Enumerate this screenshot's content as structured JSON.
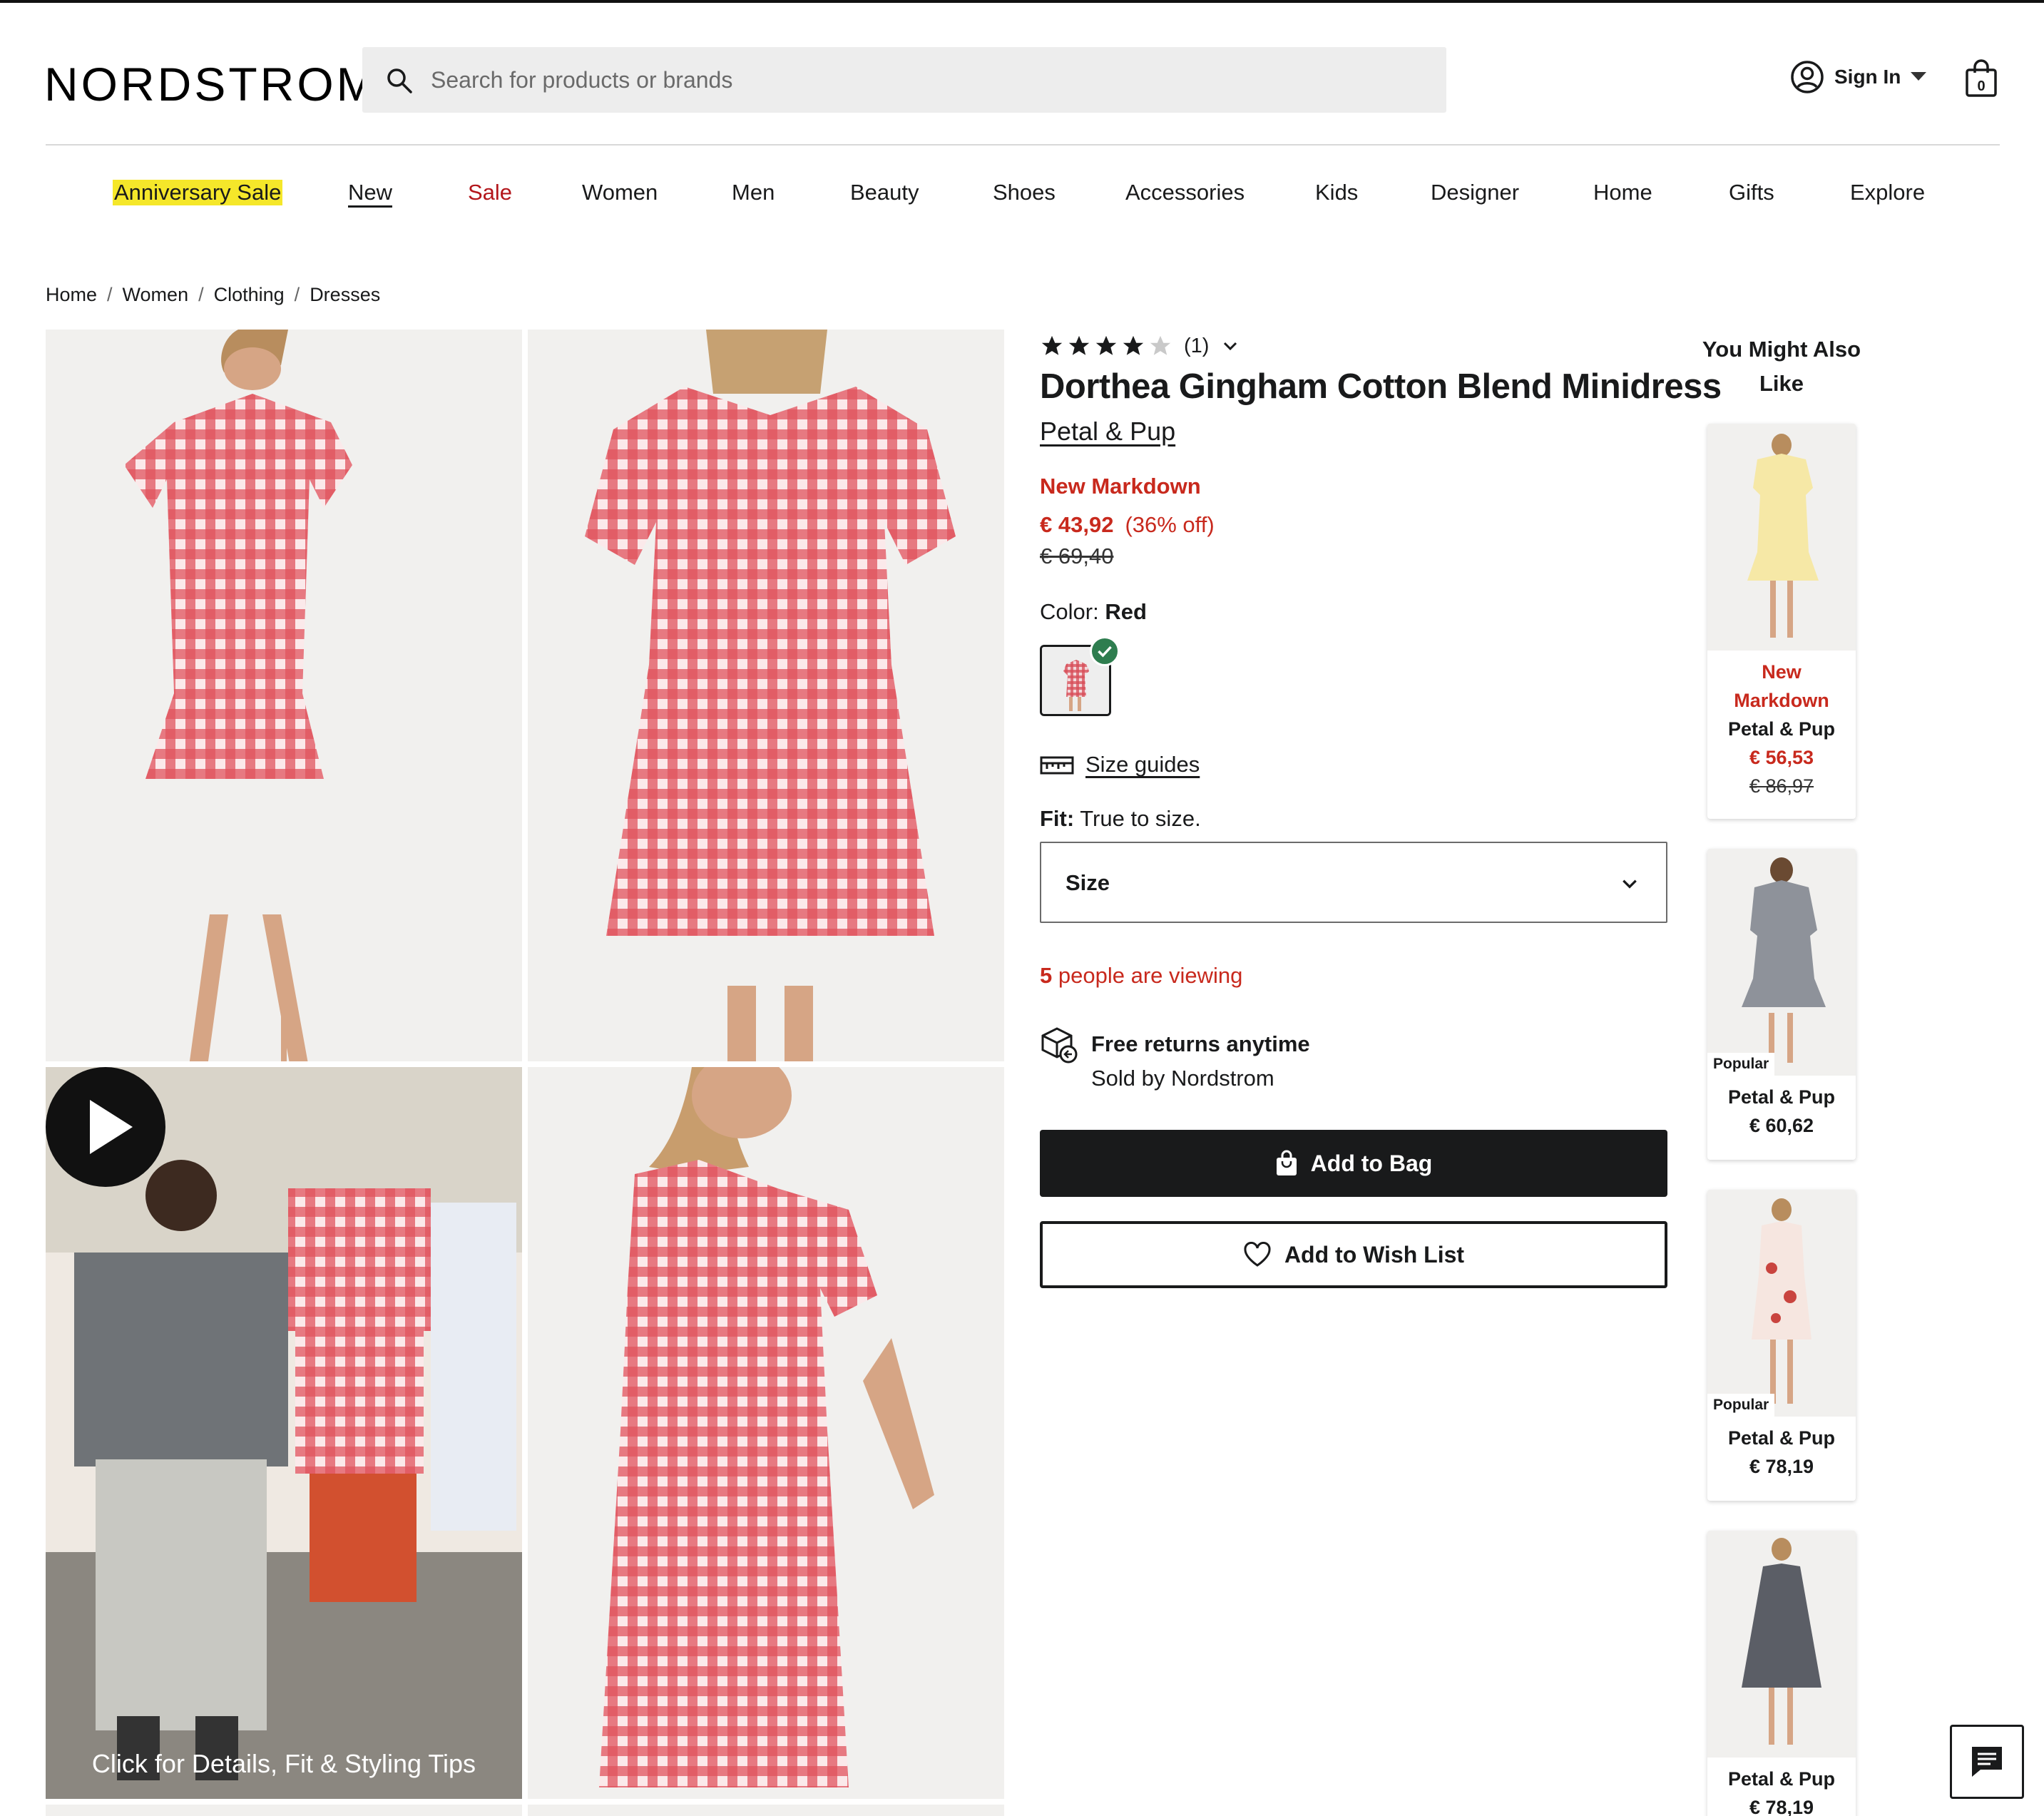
{
  "header": {
    "logo": "NORDSTROM",
    "search_placeholder": "Search for products or brands",
    "sign_in": "Sign In",
    "bag_count": "0"
  },
  "nav": [
    "Anniversary Sale",
    "New",
    "Sale",
    "Women",
    "Men",
    "Beauty",
    "Shoes",
    "Accessories",
    "Kids",
    "Designer",
    "Home",
    "Gifts",
    "Explore"
  ],
  "breadcrumb": [
    "Home",
    "Women",
    "Clothing",
    "Dresses"
  ],
  "gallery": {
    "video_caption": "Click for Details, Fit & Styling Tips"
  },
  "product": {
    "rating": 4,
    "review_count": "(1)",
    "title": "Dorthea Gingham Cotton Blend Minidress",
    "brand": "Petal & Pup",
    "markdown_label": "New Markdown",
    "price": "€ 43,92",
    "discount": "(36% off)",
    "original_price": "€ 69,40",
    "color_label": "Color:",
    "color_value": "Red",
    "size_guides": "Size guides",
    "fit_label": "Fit:",
    "fit_value": "True to size.",
    "size_select": "Size",
    "viewing_count": "5",
    "viewing_text": "people are viewing",
    "returns_title": "Free returns anytime",
    "sold_by": "Sold by Nordstrom",
    "add_to_bag": "Add to Bag",
    "add_to_wishlist": "Add to Wish List"
  },
  "recommendations": {
    "title": "You Might Also Like",
    "items": [
      {
        "badge": "",
        "markdown_line1": "New",
        "markdown_line2": "Markdown",
        "brand": "Petal & Pup",
        "price": "€ 56,53",
        "original_price": "€ 86,97"
      },
      {
        "badge": "Popular",
        "brand": "Petal & Pup",
        "price": "€ 60,62"
      },
      {
        "badge": "Popular",
        "brand": "Petal & Pup",
        "price": "€ 78,19"
      },
      {
        "badge": "",
        "brand": "Petal & Pup",
        "price": "€ 78,19"
      }
    ]
  },
  "colors": {
    "accent_red": "#c8291d",
    "nav_sale_red": "#b3161b",
    "highlight_yellow": "#f5e72a",
    "check_green": "#2e7d4f",
    "button_black": "#191a1b"
  }
}
